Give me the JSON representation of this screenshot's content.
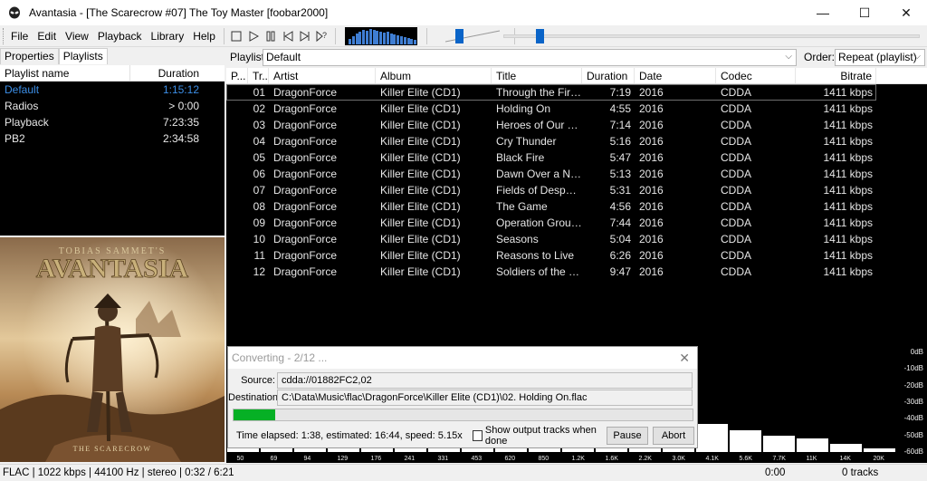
{
  "window": {
    "title": "Avantasia - [The Scarecrow #07] The Toy Master  [foobar2000]"
  },
  "menu": [
    "File",
    "Edit",
    "View",
    "Playback",
    "Library",
    "Help"
  ],
  "toolbar": {
    "buttons": [
      "stop-icon",
      "play-icon",
      "pause-icon",
      "previous-icon",
      "next-icon",
      "random-icon"
    ],
    "volume_fraction": 0.2,
    "seek_fraction": 0.08
  },
  "left_tabs": [
    "Properties",
    "Playlists"
  ],
  "playlists": {
    "columns": [
      "Playlist name",
      "Duration"
    ],
    "rows": [
      {
        "name": "Default",
        "duration": "1:15:12",
        "active": true
      },
      {
        "name": "Radios",
        "duration": "> 0:00",
        "active": false
      },
      {
        "name": "Playback",
        "duration": "7:23:35",
        "active": false
      },
      {
        "name": "PB2",
        "duration": "2:34:58",
        "active": false
      }
    ]
  },
  "album_art": {
    "artist_small": "TOBIAS SAMMET'S",
    "artist": "AVANTASIA",
    "album": "THE SCARECROW"
  },
  "playlist_bar": {
    "label": "Playlist:",
    "value": "Default",
    "order_label": "Order:",
    "order_value": "Repeat (playlist)"
  },
  "track_columns": [
    "P...",
    "Tr...",
    "Artist",
    "Album",
    "Title",
    "Duration",
    "Date",
    "Codec",
    "Bitrate"
  ],
  "tracks": [
    {
      "no": "01",
      "artist": "DragonForce",
      "album": "Killer Elite (CD1)",
      "title": "Through the Fire a...",
      "duration": "7:19",
      "date": "2016",
      "codec": "CDDA",
      "bitrate": "1411 kbps"
    },
    {
      "no": "02",
      "artist": "DragonForce",
      "album": "Killer Elite (CD1)",
      "title": "Holding On",
      "duration": "4:55",
      "date": "2016",
      "codec": "CDDA",
      "bitrate": "1411 kbps"
    },
    {
      "no": "03",
      "artist": "DragonForce",
      "album": "Killer Elite (CD1)",
      "title": "Heroes of Our Time",
      "duration": "7:14",
      "date": "2016",
      "codec": "CDDA",
      "bitrate": "1411 kbps"
    },
    {
      "no": "04",
      "artist": "DragonForce",
      "album": "Killer Elite (CD1)",
      "title": "Cry Thunder",
      "duration": "5:16",
      "date": "2016",
      "codec": "CDDA",
      "bitrate": "1411 kbps"
    },
    {
      "no": "05",
      "artist": "DragonForce",
      "album": "Killer Elite (CD1)",
      "title": "Black Fire",
      "duration": "5:47",
      "date": "2016",
      "codec": "CDDA",
      "bitrate": "1411 kbps"
    },
    {
      "no": "06",
      "artist": "DragonForce",
      "album": "Killer Elite (CD1)",
      "title": "Dawn Over a New...",
      "duration": "5:13",
      "date": "2016",
      "codec": "CDDA",
      "bitrate": "1411 kbps"
    },
    {
      "no": "07",
      "artist": "DragonForce",
      "album": "Killer Elite (CD1)",
      "title": "Fields of Despair (...",
      "duration": "5:31",
      "date": "2016",
      "codec": "CDDA",
      "bitrate": "1411 kbps"
    },
    {
      "no": "08",
      "artist": "DragonForce",
      "album": "Killer Elite (CD1)",
      "title": "The Game",
      "duration": "4:56",
      "date": "2016",
      "codec": "CDDA",
      "bitrate": "1411 kbps"
    },
    {
      "no": "09",
      "artist": "DragonForce",
      "album": "Killer Elite (CD1)",
      "title": "Operation Ground...",
      "duration": "7:44",
      "date": "2016",
      "codec": "CDDA",
      "bitrate": "1411 kbps"
    },
    {
      "no": "10",
      "artist": "DragonForce",
      "album": "Killer Elite (CD1)",
      "title": "Seasons",
      "duration": "5:04",
      "date": "2016",
      "codec": "CDDA",
      "bitrate": "1411 kbps"
    },
    {
      "no": "11",
      "artist": "DragonForce",
      "album": "Killer Elite (CD1)",
      "title": "Reasons to Live",
      "duration": "6:26",
      "date": "2016",
      "codec": "CDDA",
      "bitrate": "1411 kbps"
    },
    {
      "no": "12",
      "artist": "DragonForce",
      "album": "Killer Elite (CD1)",
      "title": "Soldiers of the Wa...",
      "duration": "9:47",
      "date": "2016",
      "codec": "CDDA",
      "bitrate": "1411 kbps"
    }
  ],
  "converter": {
    "title": "Converting - 2/12 ...",
    "source_label": "Source:",
    "source_value": "cdda://01882FC2,02",
    "destination_label": "Destination:",
    "destination_value": "C:\\Data\\Music\\flac\\DragonForce\\Killer Elite (CD1)\\02. Holding On.flac",
    "progress_fraction": 0.09,
    "time_text": "Time elapsed: 1:38, estimated: 16:44, speed: 5.15x",
    "checkbox_label": "Show output tracks when done",
    "pause_label": "Pause",
    "abort_label": "Abort"
  },
  "spectrum": {
    "db_labels": [
      "0dB",
      "-10dB",
      "-20dB",
      "-30dB",
      "-40dB",
      "-50dB",
      "-60dB"
    ],
    "freq_labels": [
      "50",
      "69",
      "94",
      "129",
      "176",
      "241",
      "331",
      "453",
      "620",
      "850",
      "1.2K",
      "1.6K",
      "2.2K",
      "3.0K",
      "4.1K",
      "5.6K",
      "7.7K",
      "11K",
      "14K",
      "20K"
    ],
    "levels_db": [
      -30,
      -32,
      -35,
      -38,
      -36,
      -40,
      -38,
      -39,
      -40,
      -42,
      -44,
      -45,
      -46,
      -42,
      -43,
      -47,
      -50,
      -52,
      -55,
      -58
    ]
  },
  "status": {
    "left": "FLAC | 1022 kbps | 44100 Hz | stereo | 0:32 / 6:21",
    "time": "0:00",
    "tracks": "0 tracks"
  },
  "colors": {
    "accent": "#0a64c8",
    "active_playlist": "#3c8ee6",
    "progress": "#06b025"
  }
}
